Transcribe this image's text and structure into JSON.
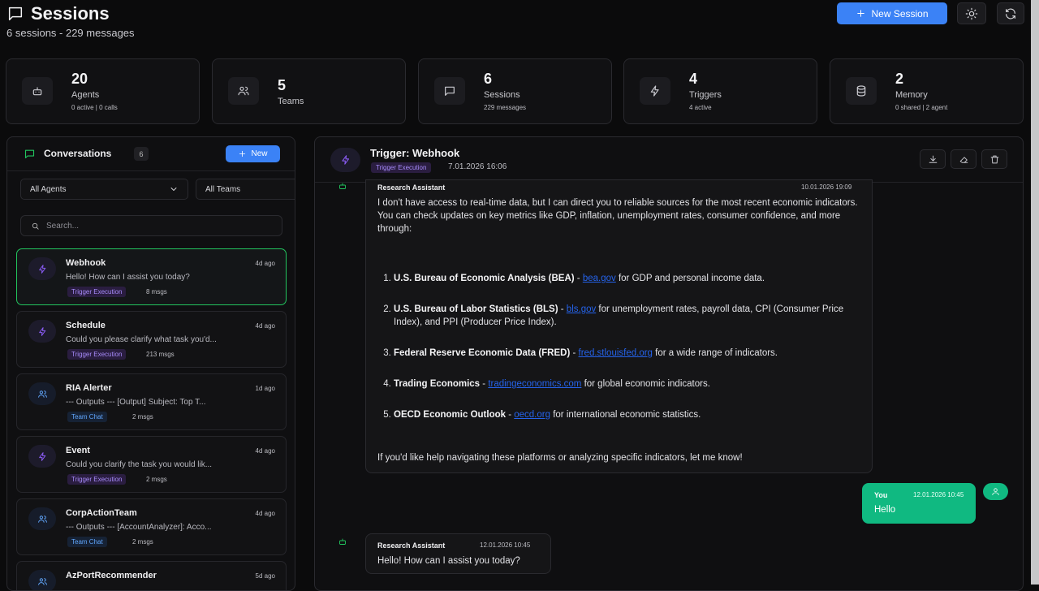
{
  "header": {
    "title": "Sessions",
    "subtitle": "6 sessions - 229 messages",
    "new_session_label": "New Session"
  },
  "stats": [
    {
      "icon": "bot-icon",
      "value": "20",
      "label": "Agents",
      "sub": "0 active | 0 calls"
    },
    {
      "icon": "users-icon",
      "value": "5",
      "label": "Teams",
      "sub": ""
    },
    {
      "icon": "chat-icon",
      "value": "6",
      "label": "Sessions",
      "sub": "229 messages"
    },
    {
      "icon": "lightning-icon",
      "value": "4",
      "label": "Triggers",
      "sub": "4 active"
    },
    {
      "icon": "database-icon",
      "value": "2",
      "label": "Memory",
      "sub": "0 shared | 2 agent"
    }
  ],
  "conversations": {
    "title": "Conversations",
    "count": "6",
    "new_label": "New",
    "agent_filter": "All Agents",
    "team_filter": "All Teams",
    "search_placeholder": "Search...",
    "items": [
      {
        "name": "Webhook",
        "time": "4d ago",
        "preview": "Hello! How can I assist you today?",
        "tag": "Trigger Execution",
        "count": "8 msgs",
        "icon": "lightning-icon"
      },
      {
        "name": "Schedule",
        "time": "4d ago",
        "preview": "Could you please clarify what task you'd...",
        "tag": "Trigger Execution",
        "count": "213 msgs",
        "icon": "lightning-icon"
      },
      {
        "name": "RIA Alerter",
        "time": "1d ago",
        "preview": "--- Outputs --- [Output] Subject: Top T...",
        "tag": "Team Chat",
        "count": "2 msgs",
        "icon": "users-icon"
      },
      {
        "name": "Event",
        "time": "4d ago",
        "preview": "Could you clarify the task you would lik...",
        "tag": "Trigger Execution",
        "count": "2 msgs",
        "icon": "lightning-icon"
      },
      {
        "name": "CorpActionTeam",
        "time": "4d ago",
        "preview": "--- Outputs --- [AccountAnalyzer]: Acco...",
        "tag": "Team Chat",
        "count": "2 msgs",
        "icon": "users-icon"
      },
      {
        "name": "AzPortRecommender",
        "time": "5d ago",
        "preview": "",
        "tag": "",
        "count": "",
        "icon": "users-icon"
      }
    ]
  },
  "chat": {
    "title": "Trigger: Webhook",
    "tag": "Trigger Execution",
    "date": "7.01.2026 16:06",
    "messages": [
      {
        "sender": "Research Assistant",
        "time": "10.01.2026 19:09",
        "intro": "I don't have access to real-time data, but I can direct you to reliable sources for the most recent economic indicators. You can check updates on key metrics like GDP, inflation, unemployment rates, consumer confidence, and more through:",
        "list": [
          {
            "bold": "U.S. Bureau of Economic Analysis (BEA)",
            "link": "bea.gov",
            "rest": " for GDP and personal income data."
          },
          {
            "bold": "U.S. Bureau of Labor Statistics (BLS)",
            "link": "bls.gov",
            "rest": " for unemployment rates, payroll data, CPI (Consumer Price Index), and PPI (Producer Price Index)."
          },
          {
            "bold": "Federal Reserve Economic Data (FRED)",
            "link": "fred.stlouisfed.org",
            "rest": " for a wide range of indicators."
          },
          {
            "bold": "Trading Economics",
            "link": "tradingeconomics.com",
            "rest": " for global economic indicators."
          },
          {
            "bold": "OECD Economic Outlook",
            "link": "oecd.org",
            "rest": " for international economic statistics."
          }
        ],
        "outro": "If you'd like help navigating these platforms or analyzing specific indicators, let me know!"
      },
      {
        "sender": "You",
        "time": "12.01.2026 10:45",
        "text": "Hello"
      },
      {
        "sender": "Research Assistant",
        "time": "12.01.2026 10:45",
        "text": "Hello! How can I assist you today?"
      }
    ]
  },
  "colors": {
    "accent_blue": "#3b82f6",
    "accent_green": "#10b981",
    "trigger_purple": "#8b5cf6"
  }
}
